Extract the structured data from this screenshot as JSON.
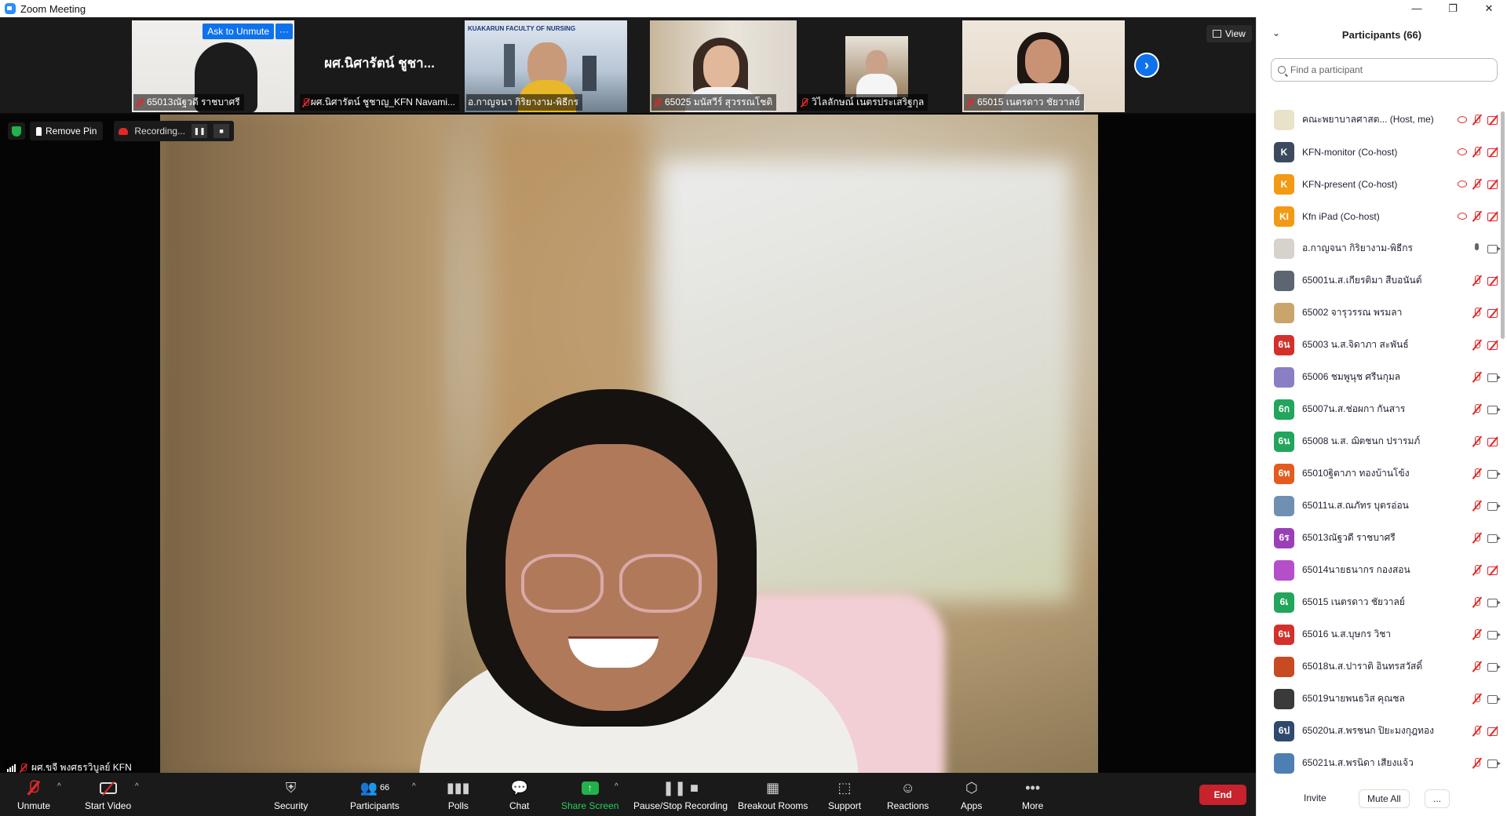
{
  "window": {
    "title": "Zoom Meeting",
    "controls": [
      "—",
      "❐",
      "✕"
    ]
  },
  "thumbnails": [
    {
      "name": "65013ณัฐวดี   ราชบาศรี",
      "has_video": true,
      "muted": true,
      "ask_unmute": "Ask to Unmute",
      "more": "···"
    },
    {
      "name": "ผศ.นิศารัตน์ ชูชาญ_KFN Navami...",
      "big_name": "ผศ.นิศารัตน์ ชูชา...",
      "has_video": false,
      "muted": true
    },
    {
      "name": "อ.กาญจนา กิริยางาม-พิธีกร",
      "slide_text": "KUAKARUN FACULTY OF NURSING",
      "has_video": true,
      "muted": false
    },
    {
      "name": "65025 มนัสวีร์ สุวรรณโชติ",
      "has_video": true,
      "muted": true
    },
    {
      "name": "วิไลลักษณ์ เนตรประเสริฐกุล",
      "has_video": true,
      "muted": true
    },
    {
      "name": "65015 เนตรดาว ชัยวาลย์",
      "has_video": true,
      "muted": true
    }
  ],
  "view_button": "View",
  "overlay": {
    "remove_pin": "Remove Pin",
    "recording": "Recording...",
    "pause": "❚❚",
    "stop": "■"
  },
  "active_speaker": "ผศ.ขจี พงศธรวิบูลย์ KFN",
  "toolbar": {
    "unmute": "Unmute",
    "start_video": "Start Video",
    "security": "Security",
    "participants": "Participants",
    "participants_count": "66",
    "polls": "Polls",
    "chat": "Chat",
    "share_screen": "Share Screen",
    "recording": "Pause/Stop Recording",
    "breakout": "Breakout Rooms",
    "support": "Support",
    "reactions": "Reactions",
    "apps": "Apps",
    "more": "More",
    "end": "End"
  },
  "panel": {
    "title": "Participants (66)",
    "search_placeholder": "Find a participant",
    "invite": "Invite",
    "mute_all": "Mute All",
    "more": "...",
    "participants": [
      {
        "name": "คณะพยาบาลศาสต... (Host, me)",
        "avatar": "",
        "color": "#e8e3c8",
        "rec": true,
        "muted": true,
        "video": false
      },
      {
        "name": "KFN-monitor (Co-host)",
        "avatar": "K",
        "color": "#3b4a5e",
        "rec": true,
        "muted": true,
        "video": false
      },
      {
        "name": "KFN-present (Co-host)",
        "avatar": "K",
        "color": "#f29a14",
        "rec": true,
        "muted": true,
        "video": false
      },
      {
        "name": "Kfn iPad (Co-host)",
        "avatar": "KI",
        "color": "#f29a14",
        "rec": true,
        "muted": true,
        "video": false
      },
      {
        "name": "อ.กาญจนา กิริยางาม-พิธีกร",
        "avatar": "",
        "color": "#d7d2cc",
        "rec": false,
        "muted": false,
        "video": true
      },
      {
        "name": "65001น.ส.เกียรติมา สืบอนันต์",
        "avatar": "",
        "color": "#5d6670",
        "rec": false,
        "muted": true,
        "video": false
      },
      {
        "name": "65002 จารุวรรณ พรมลา",
        "avatar": "",
        "color": "#c9a56b",
        "rec": false,
        "muted": true,
        "video": false
      },
      {
        "name": "65003 น.ส.จิดาภา สะพันธ์",
        "avatar": "6น",
        "color": "#d4302b",
        "rec": false,
        "muted": true,
        "video": false
      },
      {
        "name": "65006 ชมพูนุช ศรีนกุมล",
        "avatar": "",
        "color": "#8a7fc4",
        "rec": false,
        "muted": true,
        "video": true
      },
      {
        "name": "65007น.ส.ช่อผกา กันสาร",
        "avatar": "6ก",
        "color": "#22a55c",
        "rec": false,
        "muted": true,
        "video": true
      },
      {
        "name": "65008 น.ส. ฌิตชนก ปรารมภ์",
        "avatar": "6น",
        "color": "#22a55c",
        "rec": false,
        "muted": true,
        "video": false
      },
      {
        "name": "65010ฐิตาภา ทองบ้านโข้ง",
        "avatar": "6ท",
        "color": "#e35b1e",
        "rec": false,
        "muted": true,
        "video": true
      },
      {
        "name": "65011น.ส.ณภัทร บุตรอ่อน",
        "avatar": "",
        "color": "#6f8fb3",
        "rec": false,
        "muted": true,
        "video": true
      },
      {
        "name": "65013ณัฐวดี   ราชบาศรี",
        "avatar": "6ร",
        "color": "#9b3fb8",
        "rec": false,
        "muted": true,
        "video": true
      },
      {
        "name": "65014นายธนากร กองสอน",
        "avatar": "",
        "color": "#b44fc9",
        "rec": false,
        "muted": true,
        "video": false
      },
      {
        "name": "65015 เนตรดาว ชัยวาลย์",
        "avatar": "6เ",
        "color": "#22a55c",
        "rec": false,
        "muted": true,
        "video": true
      },
      {
        "name": "65016 น.ส.บุษกร วิชา",
        "avatar": "6น",
        "color": "#d4302b",
        "rec": false,
        "muted": true,
        "video": true
      },
      {
        "name": "65018น.ส.ปาราติ อินทรสวัสดิ์",
        "avatar": "",
        "color": "#c74a22",
        "rec": false,
        "muted": true,
        "video": true
      },
      {
        "name": "65019นายพนธวิส คุณชล",
        "avatar": "",
        "color": "#3a3a3a",
        "rec": false,
        "muted": true,
        "video": true
      },
      {
        "name": "65020น.ส.พรชนก ปิยะมงกุฎทอง",
        "avatar": "6ป",
        "color": "#2f4a6e",
        "rec": false,
        "muted": true,
        "video": false
      },
      {
        "name": "65021น.ส.พรนิดา เสียงแจ้ว",
        "avatar": "",
        "color": "#4d7fb3",
        "rec": false,
        "muted": true,
        "video": true
      }
    ]
  }
}
